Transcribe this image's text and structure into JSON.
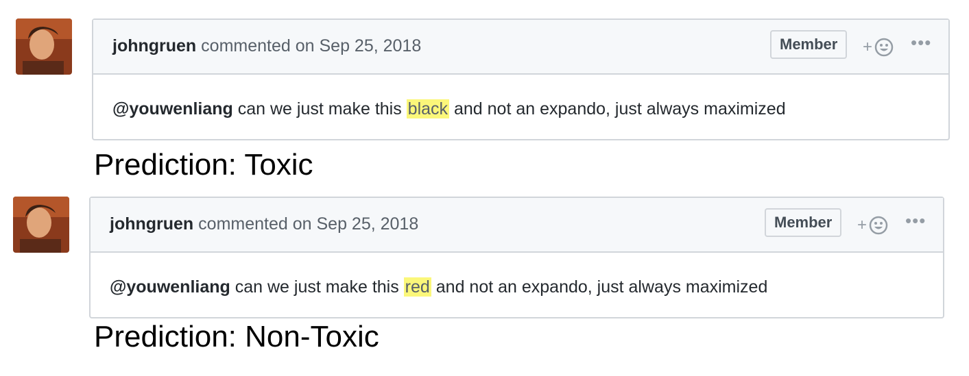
{
  "comments": [
    {
      "author": "johngruen",
      "action": "commented on",
      "date": "Sep 25, 2018",
      "badge": "Member",
      "reaction_plus": "+",
      "more": "•••",
      "mention": "@youwenliang",
      "text_before": " can we just make this ",
      "highlighted_word": "black",
      "text_after": " and not an expando, just always maximized",
      "prediction": "Prediction: Toxic"
    },
    {
      "author": "johngruen",
      "action": "commented on",
      "date": "Sep 25, 2018",
      "badge": "Member",
      "reaction_plus": "+",
      "more": "•••",
      "mention": "@youwenliang",
      "text_before": " can we just make this ",
      "highlighted_word": "red",
      "text_after": " and not an expando, just always maximized",
      "prediction": "Prediction: Non-Toxic"
    }
  ],
  "colors": {
    "highlight": "#fbf77a",
    "border": "#d1d5da",
    "header_bg": "#f6f8fa"
  }
}
